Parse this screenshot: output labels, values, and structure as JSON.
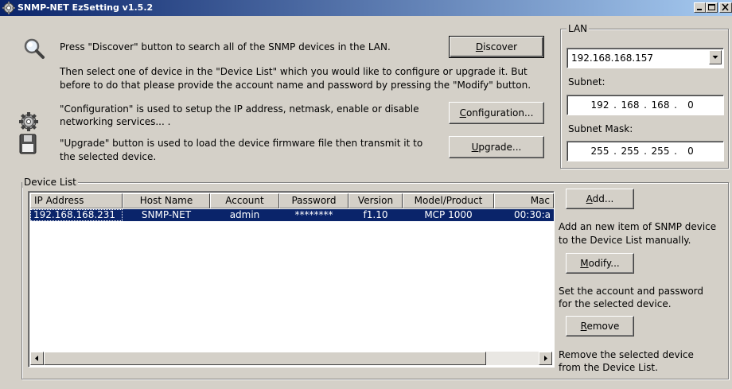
{
  "window": {
    "title": "SNMP-NET EzSetting v1.5.2"
  },
  "instructions": {
    "discover_text": "Press \"Discover\" button to search all of the SNMP devices in the LAN.",
    "select_text_1": "Then select one of device in the \"Device List\" which you would like to configure or upgrade it. But",
    "select_text_2": "before to do that please provide the account name and password by pressing the \"Modify\" button.",
    "config_text_1": "\"Configuration\" is used to setup the IP address, netmask, enable or disable",
    "config_text_2": "networking services... .",
    "upgrade_text_1": "\"Upgrade\" button is used to load the device firmware file then transmit it to",
    "upgrade_text_2": "the selected device."
  },
  "buttons": {
    "discover": {
      "acc": "D",
      "rest": "iscover"
    },
    "configuration": {
      "acc": "C",
      "rest": "onfiguration..."
    },
    "upgrade": {
      "acc": "U",
      "rest": "pgrade..."
    },
    "add": {
      "acc": "A",
      "rest": "dd..."
    },
    "modify": {
      "acc": "M",
      "rest": "odify..."
    },
    "remove": {
      "acc": "R",
      "rest": "emove"
    }
  },
  "lan": {
    "legend": "LAN",
    "selected_ip": "192.168.168.157",
    "subnet_label": "Subnet:",
    "subnet": [
      "192",
      "168",
      "168",
      "0"
    ],
    "mask_label": "Subnet Mask:",
    "mask": [
      "255",
      "255",
      "255",
      "0"
    ]
  },
  "device_list": {
    "legend": "Device List",
    "columns": [
      "IP Address",
      "Host Name",
      "Account",
      "Password",
      "Version",
      "Model/Product",
      "Mac"
    ],
    "rows": [
      [
        "192.168.168.231",
        "SNMP-NET",
        "admin",
        "********",
        "f1.10",
        "MCP 1000",
        "00:30:a"
      ]
    ]
  },
  "side_help": {
    "add_desc_1": "Add an new item of SNMP device",
    "add_desc_2": "to the Device List manually.",
    "modify_desc_1": "Set the account and password",
    "modify_desc_2": "for the selected device.",
    "remove_desc_1": "Remove the selected device",
    "remove_desc_2": "from the Device List."
  },
  "icons": {
    "title": "gear-network-icon",
    "search": "magnifier-icon",
    "config": "gear-icon",
    "upgrade": "disk-icon"
  }
}
